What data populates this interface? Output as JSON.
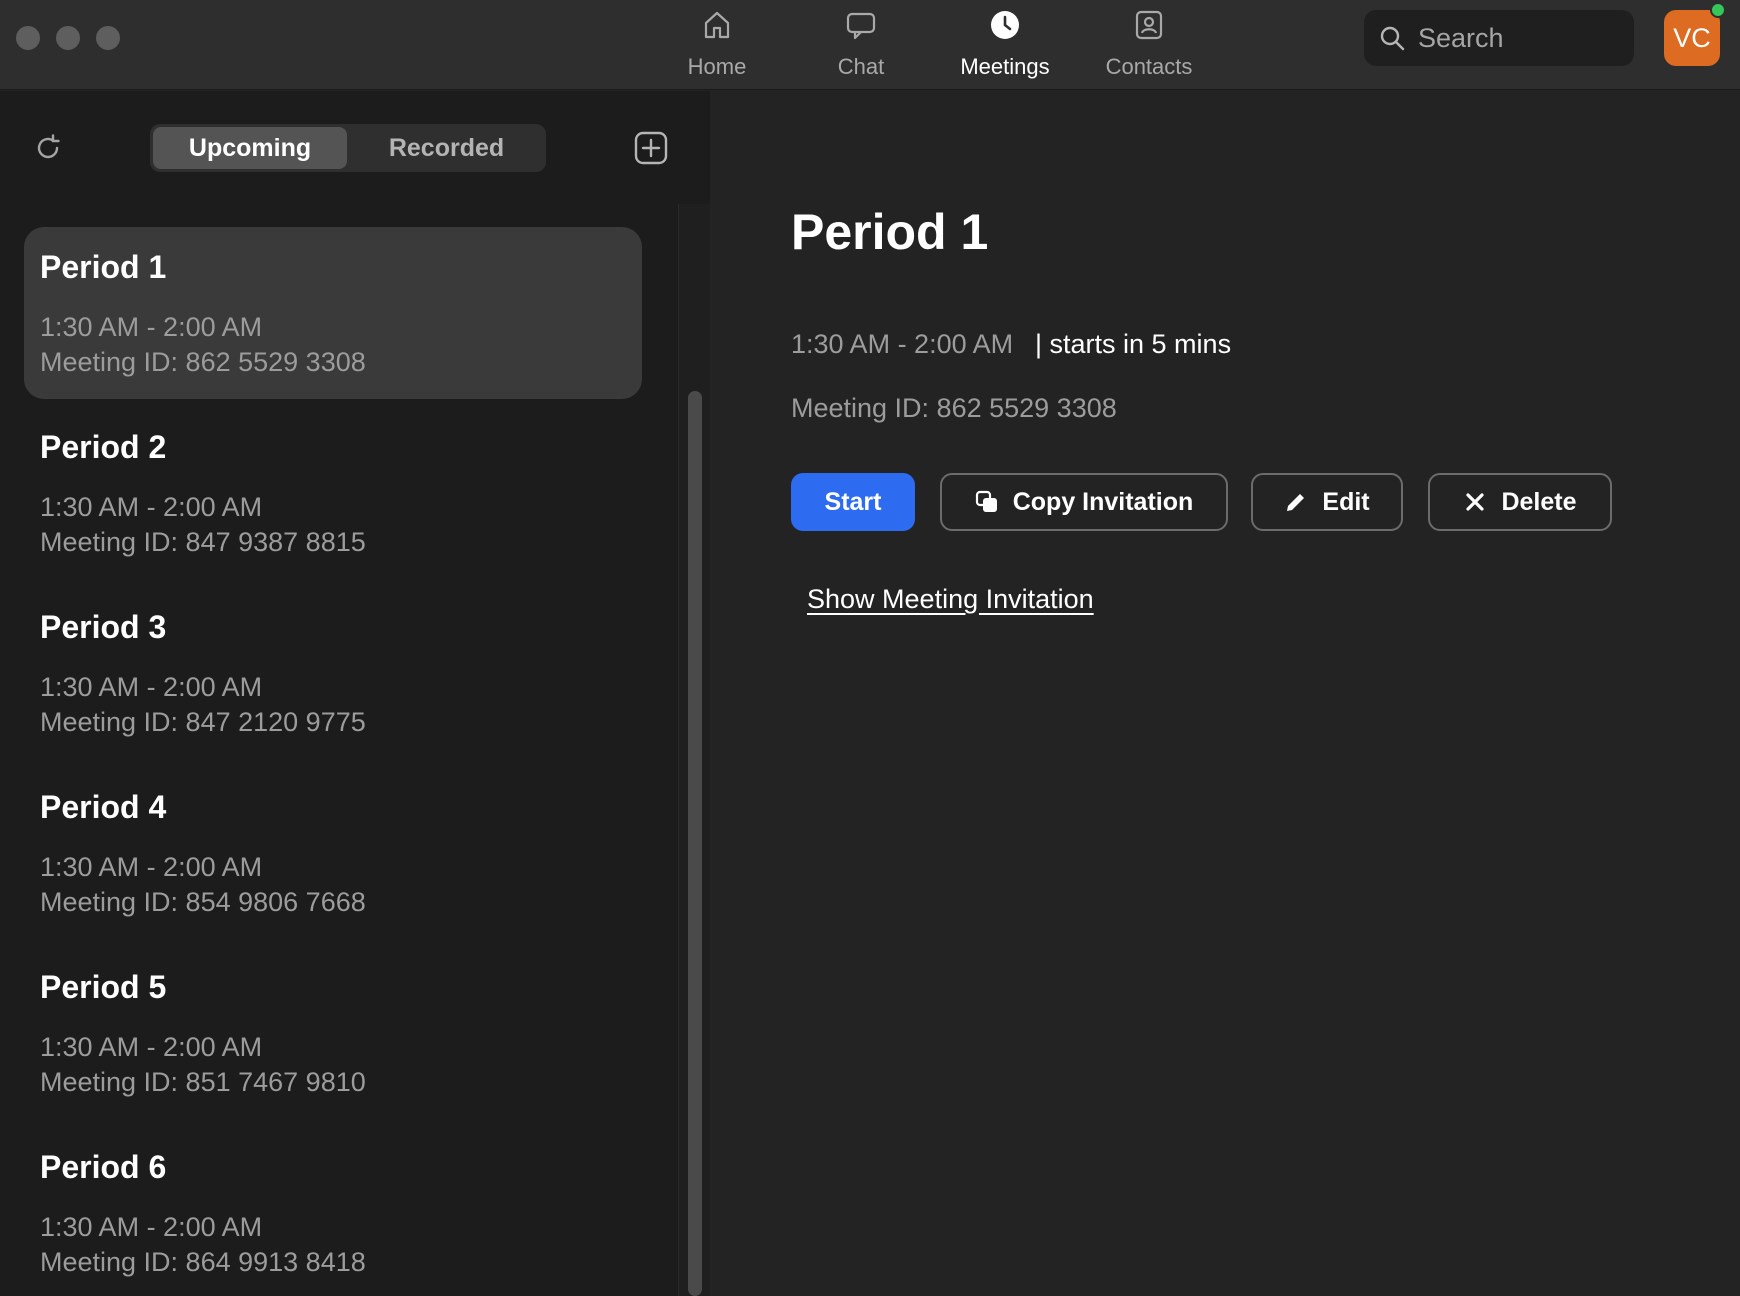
{
  "nav": {
    "tabs": [
      {
        "label": "Home",
        "icon": "home-icon",
        "active": false
      },
      {
        "label": "Chat",
        "icon": "chat-icon",
        "active": false
      },
      {
        "label": "Meetings",
        "icon": "clock-icon",
        "active": true
      },
      {
        "label": "Contacts",
        "icon": "contacts-icon",
        "active": false
      }
    ]
  },
  "search": {
    "placeholder": "Search"
  },
  "profile": {
    "initials": "VC",
    "color": "#dd6b21",
    "presence": "online"
  },
  "meetings": {
    "tabs": {
      "upcoming": "Upcoming",
      "recorded": "Recorded"
    },
    "active_tab": "Upcoming",
    "list": [
      {
        "title": "Period 1",
        "time": "1:30 AM - 2:00 AM",
        "meeting_id": "Meeting ID: 862 5529 3308",
        "selected": true
      },
      {
        "title": "Period 2",
        "time": "1:30 AM - 2:00 AM",
        "meeting_id": "Meeting ID: 847 9387 8815",
        "selected": false
      },
      {
        "title": "Period 3",
        "time": "1:30 AM - 2:00 AM",
        "meeting_id": "Meeting ID: 847 2120 9775",
        "selected": false
      },
      {
        "title": "Period 4",
        "time": "1:30 AM - 2:00 AM",
        "meeting_id": "Meeting ID: 854 9806 7668",
        "selected": false
      },
      {
        "title": "Period 5",
        "time": "1:30 AM - 2:00 AM",
        "meeting_id": "Meeting ID: 851 7467 9810",
        "selected": false
      },
      {
        "title": "Period 6",
        "time": "1:30 AM - 2:00 AM",
        "meeting_id": "Meeting ID: 864 9913 8418",
        "selected": false
      }
    ]
  },
  "detail": {
    "title": "Period 1",
    "time": "1:30 AM - 2:00 AM",
    "status": "| starts in 5 mins",
    "meeting_id": "Meeting ID: 862 5529 3308",
    "buttons": {
      "start": "Start",
      "copy": "Copy Invitation",
      "edit": "Edit",
      "delete": "Delete"
    },
    "show_invitation": "Show Meeting Invitation"
  },
  "colors": {
    "accent": "#2d6cf0",
    "background": "#232323",
    "sidebar": "#1c1c1c",
    "selected_item": "#3a3a3a"
  }
}
